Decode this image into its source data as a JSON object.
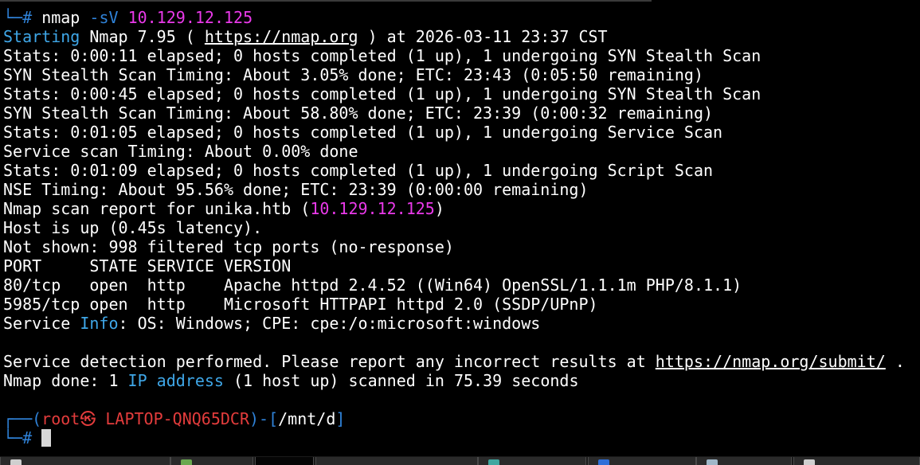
{
  "prompt_top": {
    "corner": "└─",
    "hash": "#",
    "cmd": "nmap",
    "flag": "-sV",
    "target": "10.129.12.125"
  },
  "start": {
    "label": "Starting",
    "text": " Nmap 7.95 ( ",
    "url": "https://nmap.org",
    "rest": " ) at 2026-03-11 23:37 CST"
  },
  "stats": [
    "Stats: 0:00:11 elapsed; 0 hosts completed (1 up), 1 undergoing SYN Stealth Scan",
    "SYN Stealth Scan Timing: About 3.05% done; ETC: 23:43 (0:05:50 remaining)",
    "Stats: 0:00:45 elapsed; 0 hosts completed (1 up), 1 undergoing SYN Stealth Scan",
    "SYN Stealth Scan Timing: About 58.80% done; ETC: 23:39 (0:00:32 remaining)",
    "Stats: 0:01:05 elapsed; 0 hosts completed (1 up), 1 undergoing Service Scan",
    "Service scan Timing: About 0.00% done",
    "Stats: 0:01:09 elapsed; 0 hosts completed (1 up), 1 undergoing Script Scan",
    "NSE Timing: About 95.56% done; ETC: 23:39 (0:00:00 remaining)"
  ],
  "report": {
    "prefix": "Nmap scan report for unika.htb (",
    "ip": "10.129.12.125",
    "suffix": ")"
  },
  "host_up": "Host is up (0.45s latency).",
  "not_shown": "Not shown: 998 filtered tcp ports (no-response)",
  "table_header": "PORT     STATE SERVICE VERSION",
  "ports": [
    "80/tcp   open  http    Apache httpd 2.4.52 ((Win64) OpenSSL/1.1.1m PHP/8.1.1)",
    "5985/tcp open  http    Microsoft HTTPAPI httpd 2.0 (SSDP/UPnP)"
  ],
  "service_info": {
    "prefix": "Service ",
    "label": "Info",
    "rest": ": OS: Windows; CPE: cpe:/o:microsoft:windows"
  },
  "detection": {
    "text": "Service detection performed. Please report any incorrect results at ",
    "url": "https://nmap.org/submit/",
    "end": " ."
  },
  "done": {
    "prefix": "Nmap done: 1 ",
    "label": "IP address",
    "rest": " (1 host up) scanned in 75.39 seconds"
  },
  "prompt": {
    "top_corner": "┌──(",
    "user": "root",
    "at_symbol": "㉿",
    "host": " LAPTOP-QNQ65DCR",
    "mid": ")-[",
    "path": "/mnt/d",
    "close": "]",
    "bottom_corner": "└─",
    "hash": "#"
  },
  "colors": {
    "background": "#000000",
    "text": "#ffffff",
    "prompt_blue": "#2f82d8",
    "keyword_cyan": "#3fa7e8",
    "ip_magenta": "#ea39ea",
    "root_red": "#e33c3c"
  },
  "taskbar": {
    "items": [
      "taskbar-item-1",
      "taskbar-item-2",
      "taskbar-item-3",
      "taskbar-item-4",
      "taskbar-item-5",
      "taskbar-item-6",
      "taskbar-item-7",
      "taskbar-item-8"
    ]
  }
}
